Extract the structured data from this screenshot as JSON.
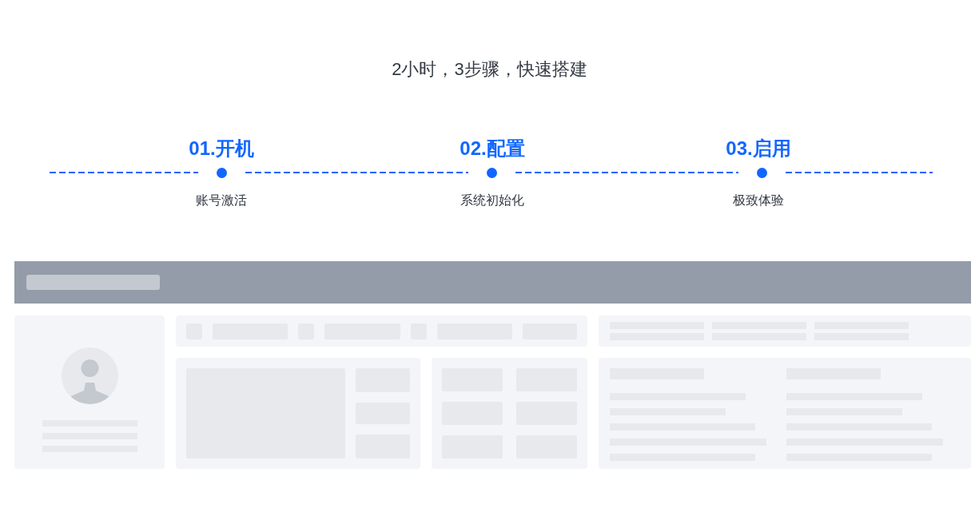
{
  "headline": "2小时，3步骤，快速搭建",
  "steps": [
    {
      "title": "01.开机",
      "description": "账号激活"
    },
    {
      "title": "02.配置",
      "description": "系统初始化"
    },
    {
      "title": "03.启用",
      "description": "极致体验"
    }
  ]
}
